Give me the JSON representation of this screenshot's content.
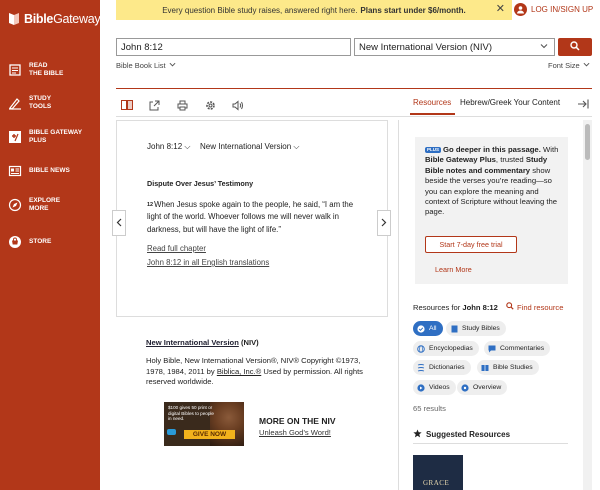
{
  "brand": {
    "name_bold": "Bible",
    "name_rest": "Gateway",
    "accent": "#b23719"
  },
  "sidebar": {
    "items": [
      {
        "label": "READ\nTHE BIBLE",
        "icon": "book-open-icon"
      },
      {
        "label": "STUDY\nTOOLS",
        "icon": "study-tools-icon"
      },
      {
        "label": "BIBLE GATEWAY\nPLUS",
        "icon": "plus-slash-icon"
      },
      {
        "label": "BIBLE NEWS",
        "icon": "news-icon"
      },
      {
        "label": "EXPLORE\nMORE",
        "icon": "compass-icon"
      },
      {
        "label": "STORE",
        "icon": "store-icon"
      }
    ]
  },
  "banner": {
    "text": "Every question Bible study raises, answered right here.",
    "cta": "Plans start under $6/month.",
    "bg": "#fde98a"
  },
  "login": {
    "label": "LOG IN/SIGN UP"
  },
  "search": {
    "passage_value": "John 8:12",
    "version_value": "New International Version (NIV)"
  },
  "subbar": {
    "book_list": "Bible Book List",
    "font_size": "Font Size"
  },
  "tabs": {
    "resources": "Resources",
    "hebrew_greek": "Hebrew/Greek Your Content"
  },
  "passage": {
    "reference": "John 8:12",
    "version": "New International Version",
    "heading": "Dispute Over Jesus’ Testimony",
    "verse_number": "12",
    "verse_text": "When Jesus spoke again to the people, he said, “I am the light of the world. Whoever follows me will never walk in darkness, but will have the light of life.”",
    "read_full": "Read full chapter",
    "all_translations": "John 8:12 in all English translations"
  },
  "copyright": {
    "version_link": "New International Version",
    "abbrev": "(NIV)",
    "text": "Holy Bible, New International Version®, NIV® Copyright ©1973, 1978, 1984, 2011 by",
    "publisher": "Biblica, Inc.®",
    "text_end": "Used by permission. All rights reserved worldwide."
  },
  "ad": {
    "text": "$100 gives 50 print or digital Bibles to people in need.",
    "button": "GIVE NOW"
  },
  "more_niv": {
    "title": "MORE ON THE NIV",
    "link": "Unleash God’s Word!"
  },
  "plus_card": {
    "badge": "PLUS",
    "headline": "Go deeper in this passage.",
    "t1": "With",
    "bold1": "Bible Gateway Plus",
    "t2": ", trusted",
    "bold2": "Study Bible notes and commentary",
    "t3": "show beside the verses you’re reading—so you can explore the meaning and context of Scripture without leaving the page.",
    "trial_button": "Start 7-day free trial",
    "learn_more": "Learn More"
  },
  "resources": {
    "label": "Resources for",
    "reference": "John 8:12",
    "find": "Find resource",
    "chips": [
      {
        "label": "All",
        "icon": "check-icon"
      },
      {
        "label": "Study Bibles",
        "icon": "bible-icon"
      },
      {
        "label": "Encyclopedias",
        "icon": "globe-icon"
      },
      {
        "label": "Commentaries",
        "icon": "chat-icon"
      },
      {
        "label": "Dictionaries",
        "icon": "dictionary-icon"
      },
      {
        "label": "Bible Studies",
        "icon": "study-icon"
      },
      {
        "label": "Videos",
        "icon": "play-icon"
      },
      {
        "label": "Overview",
        "icon": "overview-icon"
      }
    ],
    "results": "65 results",
    "suggested": "Suggested Resources",
    "cover_text": "GRACE"
  }
}
